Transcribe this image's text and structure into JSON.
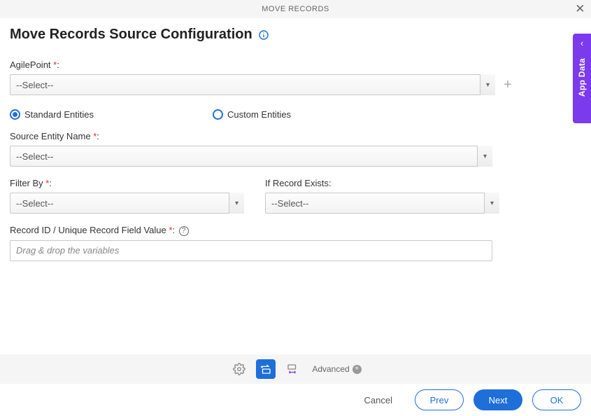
{
  "window": {
    "title": "MOVE RECORDS"
  },
  "page": {
    "title": "Move Records Source Configuration"
  },
  "fields": {
    "agilepoint": {
      "label": "AgilePoint",
      "value": "--Select--"
    },
    "entity_type": {
      "standard_label": "Standard Entities",
      "custom_label": "Custom Entities"
    },
    "source_entity": {
      "label": "Source Entity Name",
      "value": "--Select--"
    },
    "filter_by": {
      "label": "Filter By",
      "value": "--Select--"
    },
    "if_exists": {
      "label": "If Record Exists:",
      "value": "--Select--"
    },
    "record_id": {
      "label": "Record ID / Unique Record Field Value",
      "placeholder": "Drag & drop the variables"
    }
  },
  "toolbar": {
    "advanced_label": "Advanced"
  },
  "footer": {
    "cancel": "Cancel",
    "prev": "Prev",
    "next": "Next",
    "ok": "OK"
  },
  "side_panel": {
    "label": "App Data"
  }
}
